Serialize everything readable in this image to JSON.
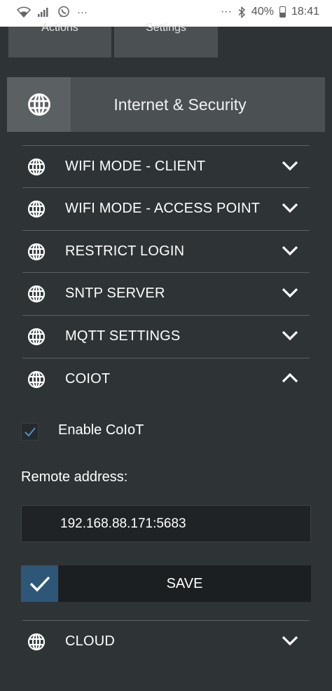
{
  "status_bar": {
    "more_left": "···",
    "more_right": "···",
    "battery": "40%",
    "time": "18:41"
  },
  "tiles": {
    "actions": "Actions",
    "settings": "Settings"
  },
  "section": {
    "title": "Internet & Security"
  },
  "rows": [
    {
      "label": "WIFI MODE - CLIENT",
      "expanded": false
    },
    {
      "label": "WIFI MODE - ACCESS POINT",
      "expanded": false
    },
    {
      "label": "RESTRICT LOGIN",
      "expanded": false
    },
    {
      "label": "SNTP SERVER",
      "expanded": false
    },
    {
      "label": "MQTT SETTINGS",
      "expanded": false
    },
    {
      "label": "COIOT",
      "expanded": true
    }
  ],
  "coiot": {
    "enable_label": "Enable CoIoT",
    "enabled": true,
    "remote_address_label": "Remote address:",
    "remote_address_value": "192.168.88.171:5683",
    "save_label": "SAVE"
  },
  "cloud_row": {
    "label": "CLOUD",
    "expanded": false
  },
  "colors": {
    "background": "#2e3436",
    "panel": "#4b5153",
    "accent": "#2e5777",
    "check": "#4a90c8"
  }
}
